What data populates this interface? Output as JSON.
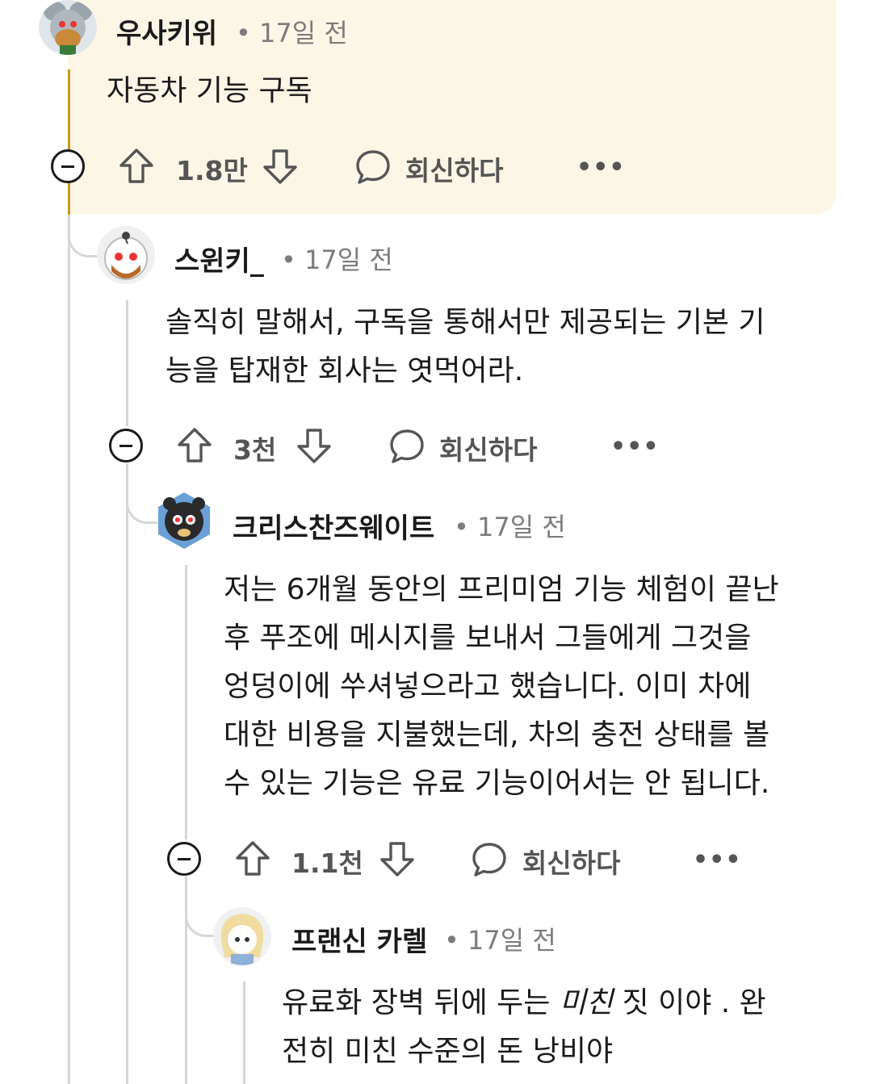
{
  "comments": [
    {
      "username": "우사키위",
      "time": "• 17일 전",
      "body": [
        "자동차 기능 구독"
      ],
      "votes": "1.8만",
      "reply_label": "회신하다",
      "more": "•••"
    },
    {
      "username": "스윈키_",
      "time": "• 17일 전",
      "body": [
        "솔직히 말해서, 구독을 통해서만 제공되는 기본 기",
        "능을 탑재한 회사는 엿먹어라."
      ],
      "votes": "3천",
      "reply_label": "회신하다",
      "more": "•••"
    },
    {
      "username": "크리스찬즈웨이트",
      "time": "• 17일 전",
      "body": [
        "저는 6개월 동안의 프리미엄 기능 체험이 끝난",
        "후 푸조에 메시지를 보내서 그들에게 그것을",
        "엉덩이에 쑤셔넣으라고 했습니다. 이미 차에",
        "대한 비용을 지불했는데, 차의 충전 상태를 볼",
        "수 있는 기능은 유료 기능이어서는 안 됩니다."
      ],
      "votes": "1.1천",
      "reply_label": "회신하다",
      "more": "•••"
    },
    {
      "username": "프랜신 카렐",
      "time": "• 17일 전",
      "body_pre": "유료화 장벽 뒤에 두는 ",
      "body_em": "미친",
      "body_post": " 짓 이야 . 완",
      "body_line2": "전히 미친 수준의 돈 낭비야"
    }
  ]
}
